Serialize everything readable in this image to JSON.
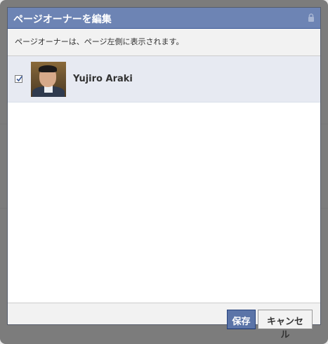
{
  "dialog": {
    "title": "ページオーナーを編集",
    "description": "ページオーナーは、ページ左側に表示されます。",
    "owner": {
      "name": "Yujiro Araki",
      "checked": true
    },
    "buttons": {
      "save_label": "保存",
      "cancel_label": "キャンセル"
    }
  },
  "colors": {
    "titlebar": "#6d84b4",
    "save_button": "#5b74a8",
    "row_highlight": "#e7eaf2"
  },
  "icons": [
    "lock-icon",
    "checkmark-icon"
  ]
}
